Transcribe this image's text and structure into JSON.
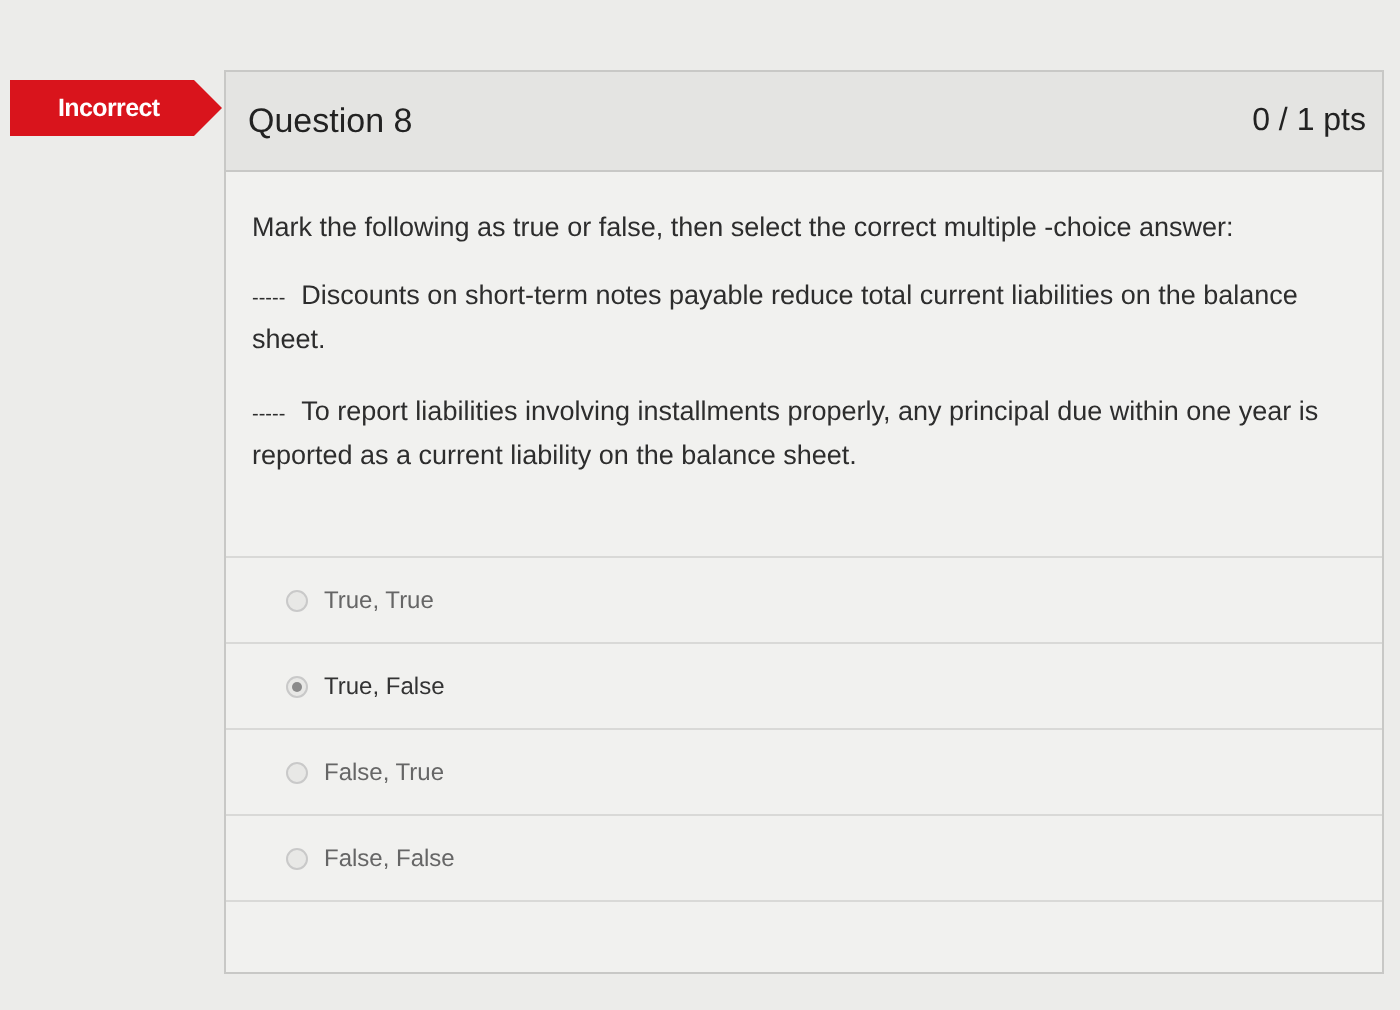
{
  "result_badge": "Incorrect",
  "question": {
    "title": "Question 8",
    "points": "0 / 1 pts",
    "prompt": "Mark the following as true or false, then select the correct multiple -choice answer:",
    "statements": [
      {
        "blank": "-----",
        "text": "Discounts on short-term notes payable reduce total current liabilities on the balance sheet."
      },
      {
        "blank": "-----",
        "text": "To report liabilities involving installments properly, any principal due within one year is reported as a current liability on the balance sheet."
      }
    ],
    "answers": [
      {
        "label": "True, True",
        "selected": false
      },
      {
        "label": "True, False",
        "selected": true
      },
      {
        "label": "False, True",
        "selected": false
      },
      {
        "label": "False, False",
        "selected": false
      }
    ]
  }
}
